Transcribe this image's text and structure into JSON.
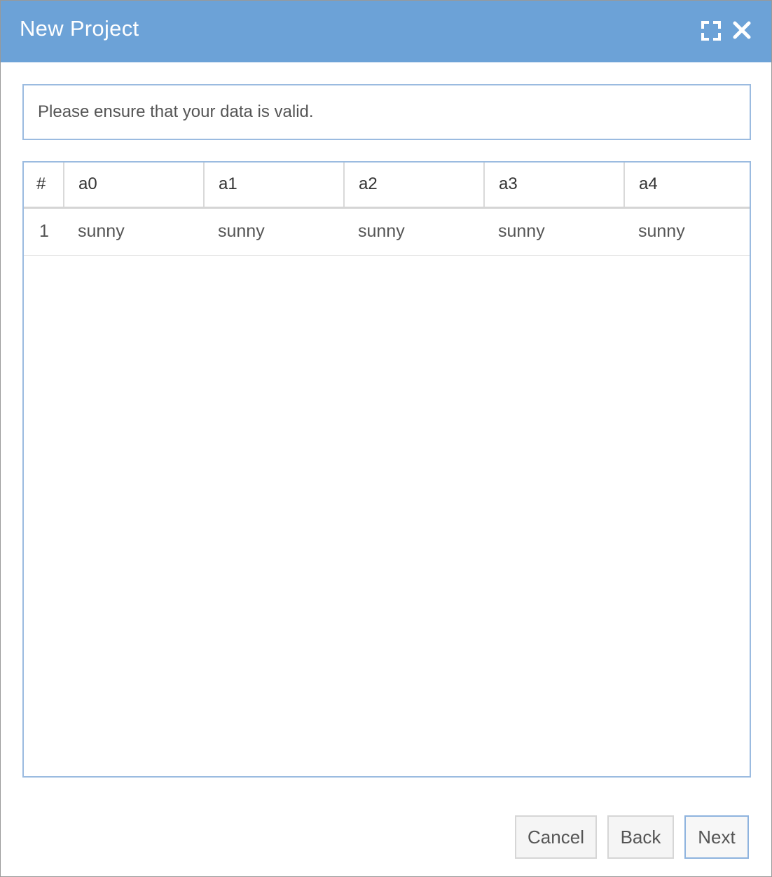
{
  "dialog": {
    "title": "New Project",
    "maximize_icon": "maximize-icon",
    "close_icon": "close-icon",
    "header_color": "#6ca2d7"
  },
  "message": "Please ensure that your data is valid.",
  "table": {
    "columns": [
      "#",
      "a0",
      "a1",
      "a2",
      "a3",
      "a4"
    ],
    "rows": [
      [
        "1",
        "sunny",
        "sunny",
        "sunny",
        "sunny",
        "sunny"
      ]
    ]
  },
  "footer": {
    "cancel_label": "Cancel",
    "back_label": "Back",
    "next_label": "Next"
  }
}
